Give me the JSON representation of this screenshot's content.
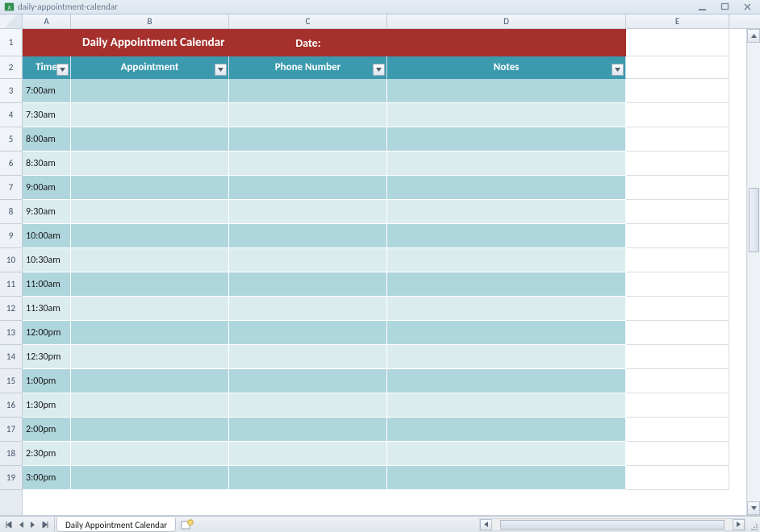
{
  "window": {
    "title": "daily-appointment-calendar"
  },
  "columns": [
    "A",
    "B",
    "C",
    "D",
    "E"
  ],
  "rownums": [
    "1",
    "2",
    "3",
    "4",
    "5",
    "6",
    "7",
    "8",
    "9",
    "10",
    "11",
    "12",
    "13",
    "14",
    "15",
    "16",
    "17",
    "18",
    "19"
  ],
  "title_row": {
    "heading": "Daily Appointment Calendar",
    "date_label": "Date:"
  },
  "headers": {
    "time": "Time",
    "appointment": "Appointment",
    "phone": "Phone Number",
    "notes": "Notes"
  },
  "times": [
    "7:00am",
    "7:30am",
    "8:00am",
    "8:30am",
    "9:00am",
    "9:30am",
    "10:00am",
    "10:30am",
    "11:00am",
    "11:30am",
    "12:00pm",
    "12:30pm",
    "1:00pm",
    "1:30pm",
    "2:00pm",
    "2:30pm",
    "3:00pm"
  ],
  "sheet_tab": "Daily Appointment Calendar"
}
